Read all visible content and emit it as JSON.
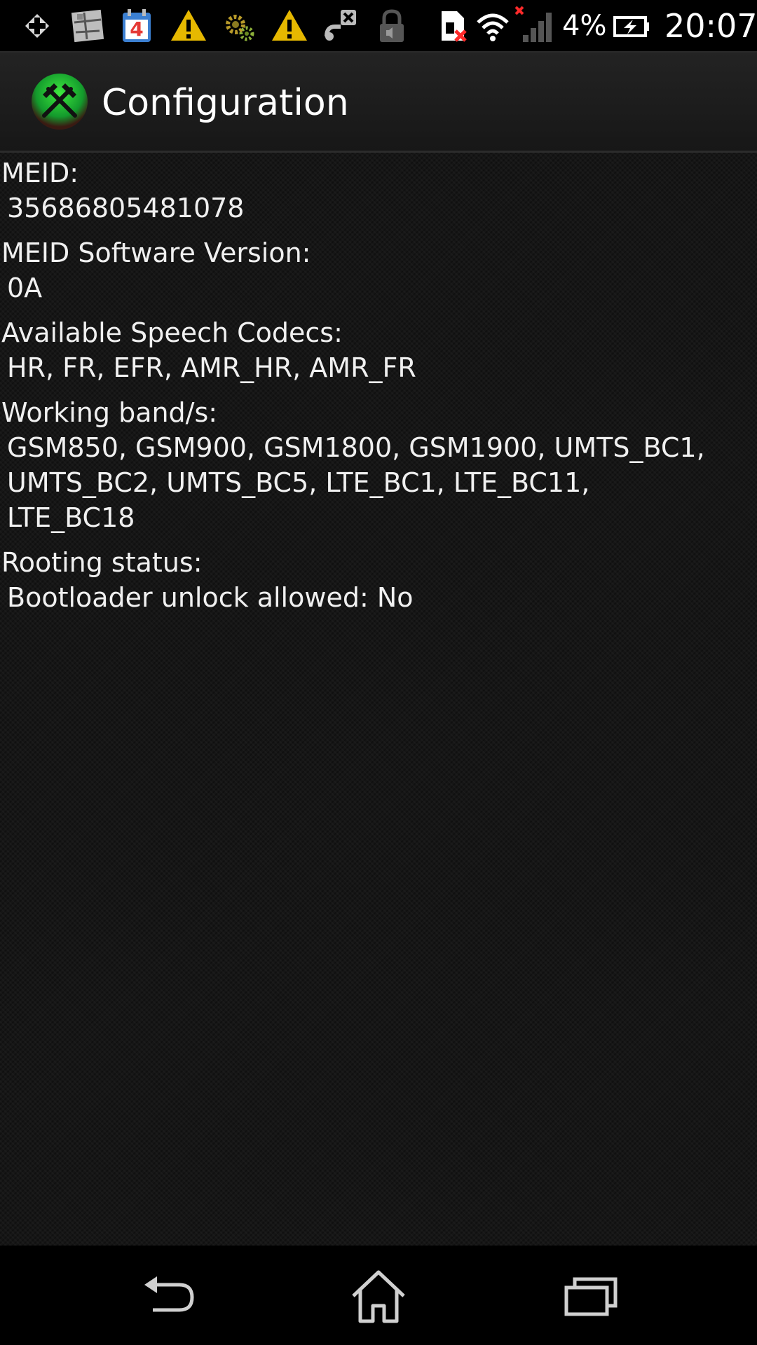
{
  "status_bar": {
    "icons": [
      "plus-icon",
      "photo-collage-icon",
      "calendar-icon",
      "warning-icon",
      "gears-icon",
      "warning-icon",
      "usb-debug-icon",
      "locked-volume-icon",
      "no-sim-icon",
      "wifi-icon",
      "signal-no-service-icon",
      "battery-charging-icon"
    ],
    "calendar_day": "4",
    "battery_percent": "4%",
    "time": "20:07"
  },
  "action_bar": {
    "title": "Configuration",
    "logo_icon": "crossed-hammers-icon"
  },
  "sections": [
    {
      "label": "MEID:",
      "value": "35686805481078"
    },
    {
      "label": "MEID Software Version:",
      "value": "0A"
    },
    {
      "label": "Available Speech Codecs:",
      "value": "HR, FR, EFR, AMR_HR, AMR_FR"
    },
    {
      "label": "Working band/s:",
      "value": "GSM850, GSM900, GSM1800, GSM1900, UMTS_BC1, UMTS_BC2, UMTS_BC5, LTE_BC1, LTE_BC11, LTE_BC18"
    },
    {
      "label": "Rooting status:",
      "value": "Bootloader unlock allowed: No"
    }
  ],
  "nav_bar": {
    "buttons": [
      "back-icon",
      "home-icon",
      "recent-apps-icon"
    ]
  },
  "colors": {
    "background": "#161616",
    "bars": "#000000",
    "text": "#f0f0f0",
    "warning": "#e6b800",
    "calendar_red": "#e53935",
    "no_signal_red": "#ff2a2a"
  }
}
